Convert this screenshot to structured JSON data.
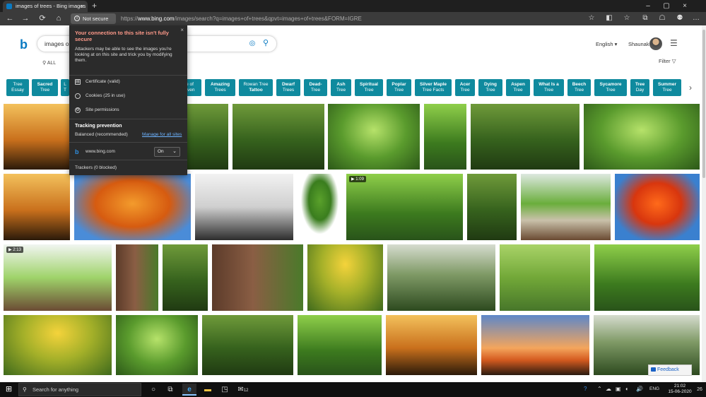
{
  "browser": {
    "tab_title": "images of trees - Bing images",
    "tab_close": "×",
    "new_tab": "+",
    "window_controls": [
      "–",
      "▢",
      "×"
    ],
    "nav": {
      "back": "←",
      "forward": "→",
      "refresh": "⟳",
      "home": "⌂"
    },
    "site_info_label": "Not secure",
    "url_prefix": "https://",
    "url_host": "www.bing.com",
    "url_rest": "/images/search?q=images+of+trees&qpvt=images+of+trees&FORM=IGRE",
    "toolbar_icons": [
      "☆",
      "◧",
      "☆",
      "⧉",
      "☖",
      "⚉",
      "…"
    ]
  },
  "bing": {
    "logo": "b",
    "search_text": "images o",
    "scope_all": "ALL",
    "language": "English ▾",
    "user_name": "Shaunak",
    "filter_label": "Filter ▽",
    "chips": [
      {
        "line1": "Tree",
        "line2": "Essay"
      },
      {
        "line1": "Sacred",
        "line2": "Tree"
      },
      {
        "line1": "L",
        "line2": "T"
      },
      {
        "line1": "e of",
        "line2": "aven"
      },
      {
        "line1": "Amazing",
        "line2": "Trees"
      },
      {
        "line1": "Rowan Tree",
        "line2": "Tattoo"
      },
      {
        "line1": "Dwarf",
        "line2": "Trees"
      },
      {
        "line1": "Dead-",
        "line2": "Tree"
      },
      {
        "line1": "Ash",
        "line2": "Tree"
      },
      {
        "line1": "Spiritual",
        "line2": "Tree"
      },
      {
        "line1": "Poplar",
        "line2": "Tree"
      },
      {
        "line1": "Silver Maple",
        "line2": "Tree Facts"
      },
      {
        "line1": "Acer",
        "line2": "Tree"
      },
      {
        "line1": "Dying",
        "line2": "Tree"
      },
      {
        "line1": "Aspen",
        "line2": "Tree"
      },
      {
        "line1": "What Is a",
        "line2": "Tree"
      },
      {
        "line1": "Beech",
        "line2": "Tree"
      },
      {
        "line1": "Sycamore",
        "line2": "Tree"
      },
      {
        "line1": "Tree",
        "line2": "Day"
      },
      {
        "line1": "Summer",
        "line2": "Tree"
      }
    ],
    "chip_next": "›",
    "badges": {
      "video1": "▶ 1:09",
      "video2": "▶ 2:13"
    },
    "feedback": "Feedback"
  },
  "popup": {
    "close": "×",
    "title": "Your connection to this site isn't fully secure",
    "warning": "Attackers may be able to see the images you're looking at on this site and trick you by modifying them.",
    "certificate": "Certificate (valid)",
    "cookies": "Cookies (25 in use)",
    "permissions": "Site permissions",
    "tracking_title": "Tracking prevention",
    "tracking_level": "Balanced (recommended)",
    "manage_link": "Manage for all sites",
    "site": "www.bing.com",
    "site_setting": "On",
    "trackers": "Trackers (0 blocked)"
  },
  "taskbar": {
    "search_placeholder": "Search for anything",
    "apps": [
      "○",
      "⧉",
      "e",
      "▬",
      "◳",
      "✉"
    ],
    "tray": [
      "?",
      "⌃",
      "☁",
      "▣",
      "◐",
      "🔊",
      "ENG"
    ],
    "time": "21:02",
    "date": "15-06-2020",
    "notif_count": "26",
    "mail_count": "12"
  }
}
